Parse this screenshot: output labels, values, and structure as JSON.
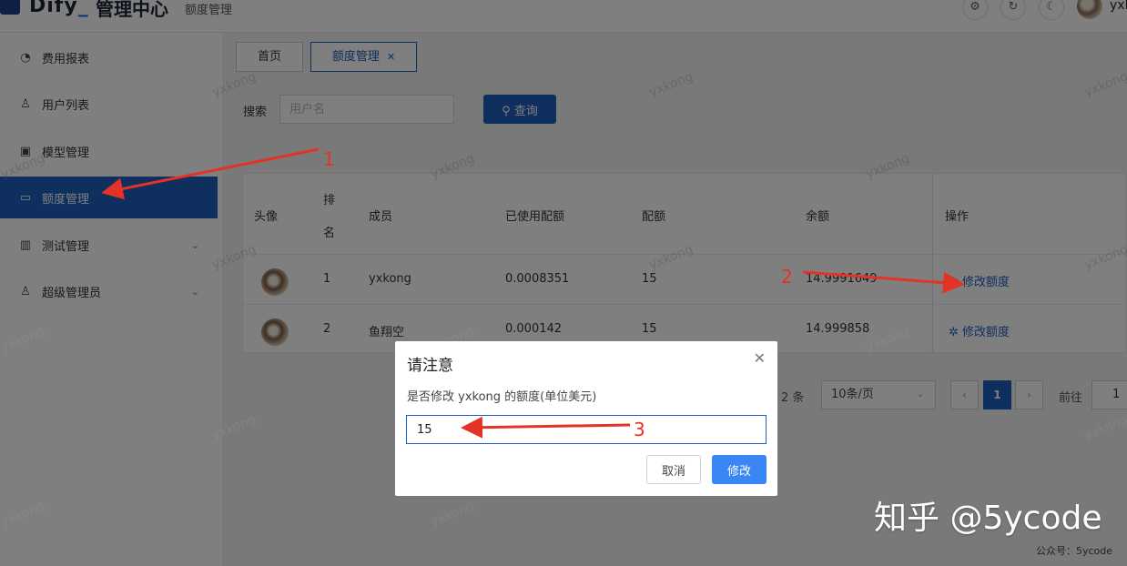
{
  "header": {
    "logo_text": "Dify",
    "logo_suffix": "管理中心",
    "crumb": "额度管理",
    "user_name": "yxk"
  },
  "sidebar": {
    "items": [
      {
        "label": "费用报表",
        "icon": "dashboard-icon"
      },
      {
        "label": "用户列表",
        "icon": "user-icon"
      },
      {
        "label": "模型管理",
        "icon": "box-icon"
      },
      {
        "label": "额度管理",
        "icon": "folder-icon",
        "active": true
      },
      {
        "label": "测试管理",
        "icon": "book-icon",
        "expandable": true
      },
      {
        "label": "超级管理员",
        "icon": "user-icon",
        "expandable": true
      }
    ]
  },
  "tabs": [
    {
      "label": "首页"
    },
    {
      "label": "额度管理",
      "active": true
    }
  ],
  "search": {
    "label": "搜索",
    "placeholder": "用户名",
    "button": "查询"
  },
  "table": {
    "headers": {
      "avatar": "头像",
      "rank_line1": "排",
      "rank_line2": "名",
      "member": "成员",
      "used": "已使用配额",
      "quota": "配额",
      "balance": "余额",
      "action": "操作"
    },
    "rows": [
      {
        "rank": "1",
        "member": "yxkong",
        "used": "0.0008351",
        "quota": "15",
        "balance": "14.9991649",
        "action": "修改额度"
      },
      {
        "rank": "2",
        "member": "鱼翔空",
        "used": "0.000142",
        "quota": "15",
        "balance": "14.999858",
        "action": "修改额度"
      }
    ]
  },
  "pagination": {
    "total": "2 条",
    "page_size": "10条/页",
    "current": "1",
    "goto_label": "前往",
    "goto_value": "1"
  },
  "dialog": {
    "title": "请注意",
    "message": "是否修改 yxkong 的额度(单位美元)",
    "input_value": "15",
    "cancel": "取消",
    "confirm": "修改"
  },
  "annotations": [
    "1",
    "2",
    "3"
  ],
  "watermark": "yxkong",
  "footer": {
    "brand": "知乎 @5ycode",
    "account": "公众号：5ycode"
  },
  "colors": {
    "primary": "#1f5fbf",
    "confirm": "#3a86f4",
    "annotation": "#e53226"
  }
}
